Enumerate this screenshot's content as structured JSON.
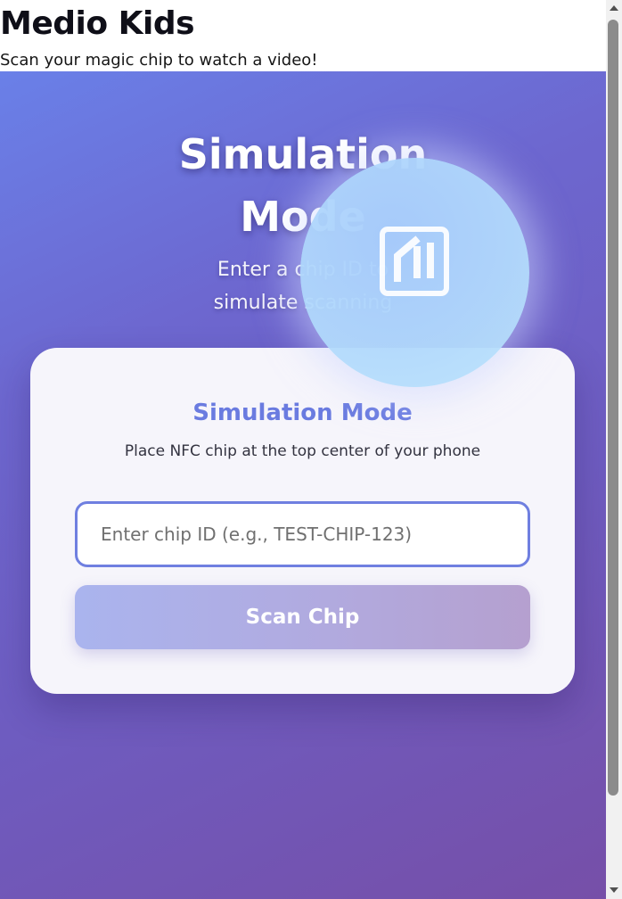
{
  "header": {
    "title": "Medio Kids",
    "subtitle": "Scan your magic chip to watch a video!"
  },
  "hero": {
    "title_lines": [
      "Simulation",
      "Mode"
    ],
    "subtitle_lines": [
      "Enter a chip ID to",
      "simulate scanning"
    ],
    "icon": "nfc-icon"
  },
  "card": {
    "title": "Simulation Mode",
    "instruction": "Place NFC chip at the top center of your phone",
    "chip_input": {
      "value": "",
      "placeholder": "Enter chip ID (e.g., TEST-CHIP-123)"
    },
    "scan_button_label": "Scan Chip"
  },
  "colors": {
    "accent": "#6a7be0",
    "background_gradient_start": "#6a80e8",
    "background_gradient_end": "#764fa8",
    "card_background": "#f6f5fb",
    "bubble": "#b0d6fb"
  }
}
